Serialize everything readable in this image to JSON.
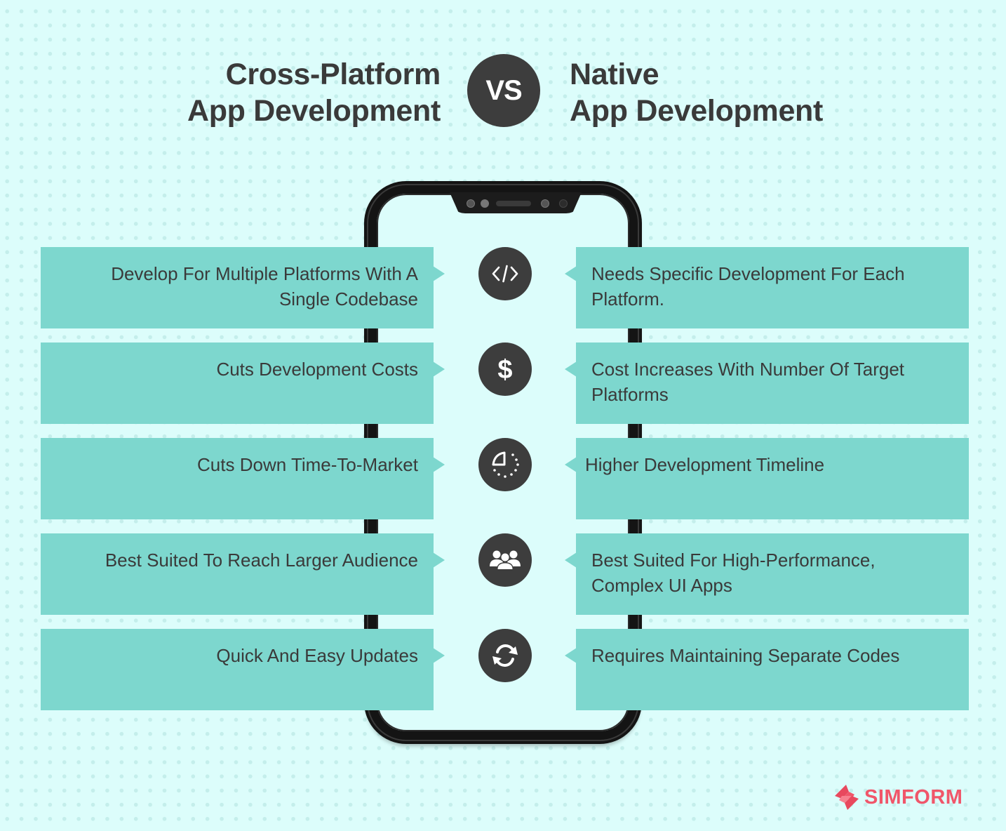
{
  "header": {
    "left_title": [
      "Cross-Platform",
      "App Development"
    ],
    "vs_label": "VS",
    "right_title": [
      "Native",
      "App Development"
    ]
  },
  "colors": {
    "background": "#dcfdfb",
    "card": "#7dd7ce",
    "icon_circle": "#3d3d3d",
    "text": "#3a3a3a",
    "brand": "#f0566a"
  },
  "rows": [
    {
      "icon": "code-icon",
      "cross_platform": [
        "Develop For Multiple Platforms With A",
        "Single Codebase"
      ],
      "native": [
        "Needs Specific Development For Each",
        "Platform."
      ]
    },
    {
      "icon": "dollar-icon",
      "cross_platform": [
        "Cuts Development Costs"
      ],
      "native": [
        "Cost Increases With Number Of Target",
        "Platforms"
      ]
    },
    {
      "icon": "timer-icon",
      "cross_platform": [
        "Cuts Down Time-To-Market"
      ],
      "native": [
        "Higher Development Timeline"
      ]
    },
    {
      "icon": "users-icon",
      "cross_platform": [
        "Best Suited To Reach Larger Audience"
      ],
      "native": [
        "Best Suited For High-Performance,",
        "Complex UI Apps"
      ]
    },
    {
      "icon": "refresh-icon",
      "cross_platform": [
        "Quick And Easy Updates"
      ],
      "native": [
        "Requires Maintaining Separate Codes"
      ]
    }
  ],
  "brand": {
    "logo_text": "SIMFORM",
    "logo_icon": "simform-logo-icon"
  }
}
